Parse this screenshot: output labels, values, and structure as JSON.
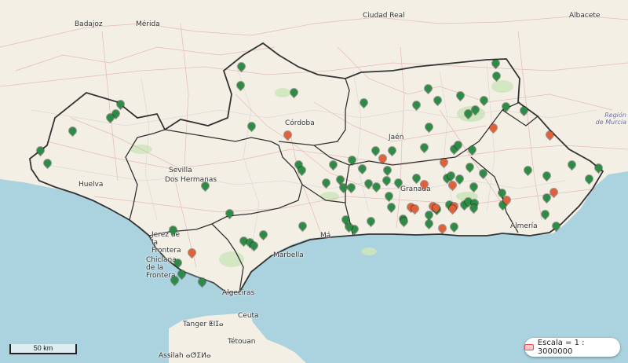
{
  "map": {
    "places": [
      {
        "id": "badajoz",
        "label": "Badajoz",
        "type": "city"
      },
      {
        "id": "merida",
        "label": "Mérida",
        "type": "city"
      },
      {
        "id": "ciudad-real",
        "label": "Ciudad Real",
        "type": "city"
      },
      {
        "id": "albacete",
        "label": "Albacete",
        "type": "city"
      },
      {
        "id": "cordoba",
        "label": "Córdoba",
        "type": "city"
      },
      {
        "id": "jaen",
        "label": "Jaén",
        "type": "city"
      },
      {
        "id": "sevilla",
        "label": "Sevilla",
        "type": "city"
      },
      {
        "id": "dos-hermanas",
        "label": "Dos Hermanas",
        "type": "city"
      },
      {
        "id": "huelva",
        "label": "Huelva",
        "type": "city"
      },
      {
        "id": "granada",
        "label": "Granada",
        "type": "city"
      },
      {
        "id": "jerez",
        "label": "Jerez de la Frontera",
        "type": "city"
      },
      {
        "id": "chiclana",
        "label": "Chiclana de la Frontera",
        "type": "city"
      },
      {
        "id": "marbella",
        "label": "Marbella",
        "type": "city"
      },
      {
        "id": "malaga",
        "label": "Má",
        "type": "city"
      },
      {
        "id": "almeria",
        "label": "Almería",
        "type": "city"
      },
      {
        "id": "algeciras",
        "label": "Algeciras",
        "type": "city"
      },
      {
        "id": "ceuta",
        "label": "Ceuta",
        "type": "city"
      },
      {
        "id": "tanger",
        "label": "Tanger ⵟⵏⵊⴰ",
        "type": "city"
      },
      {
        "id": "tetouan",
        "label": "Tétouan",
        "type": "city"
      },
      {
        "id": "assilah",
        "label": "Assilah ⴰⵚⵉⵍⴰ",
        "type": "city"
      },
      {
        "id": "murcia",
        "label": "Región de Murcia",
        "type": "region"
      }
    ],
    "marker_colors": {
      "green": "#2e8b45",
      "orange": "#e0603a"
    },
    "markers_green_count": 89,
    "markers_orange_count": 17
  },
  "scalebar": {
    "label": "50 km"
  },
  "scale_legend": {
    "label": "Escala = 1 : 3000000"
  }
}
